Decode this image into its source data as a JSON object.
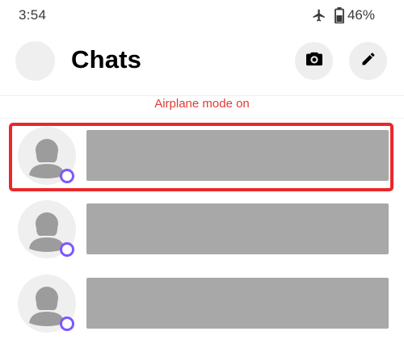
{
  "status_bar": {
    "time": "3:54",
    "battery": "46%",
    "icons": [
      "airplane-icon",
      "battery-icon"
    ]
  },
  "header": {
    "title": "Chats",
    "actions": [
      "camera-icon",
      "pencil-icon"
    ]
  },
  "banner": {
    "text": "Airplane mode on",
    "color": "#e53935"
  },
  "chats": [
    {
      "avatar": "person-silhouette-icon",
      "status": "online",
      "preview": "",
      "highlighted": true
    },
    {
      "avatar": "person-silhouette-icon",
      "status": "online",
      "preview": "",
      "highlighted": false
    },
    {
      "avatar": "person-silhouette-icon",
      "status": "online",
      "preview": "",
      "highlighted": false
    }
  ],
  "colors": {
    "highlight": "#e8282b",
    "presence": "#7e57ff",
    "placeholder": "#a8a8a8"
  }
}
